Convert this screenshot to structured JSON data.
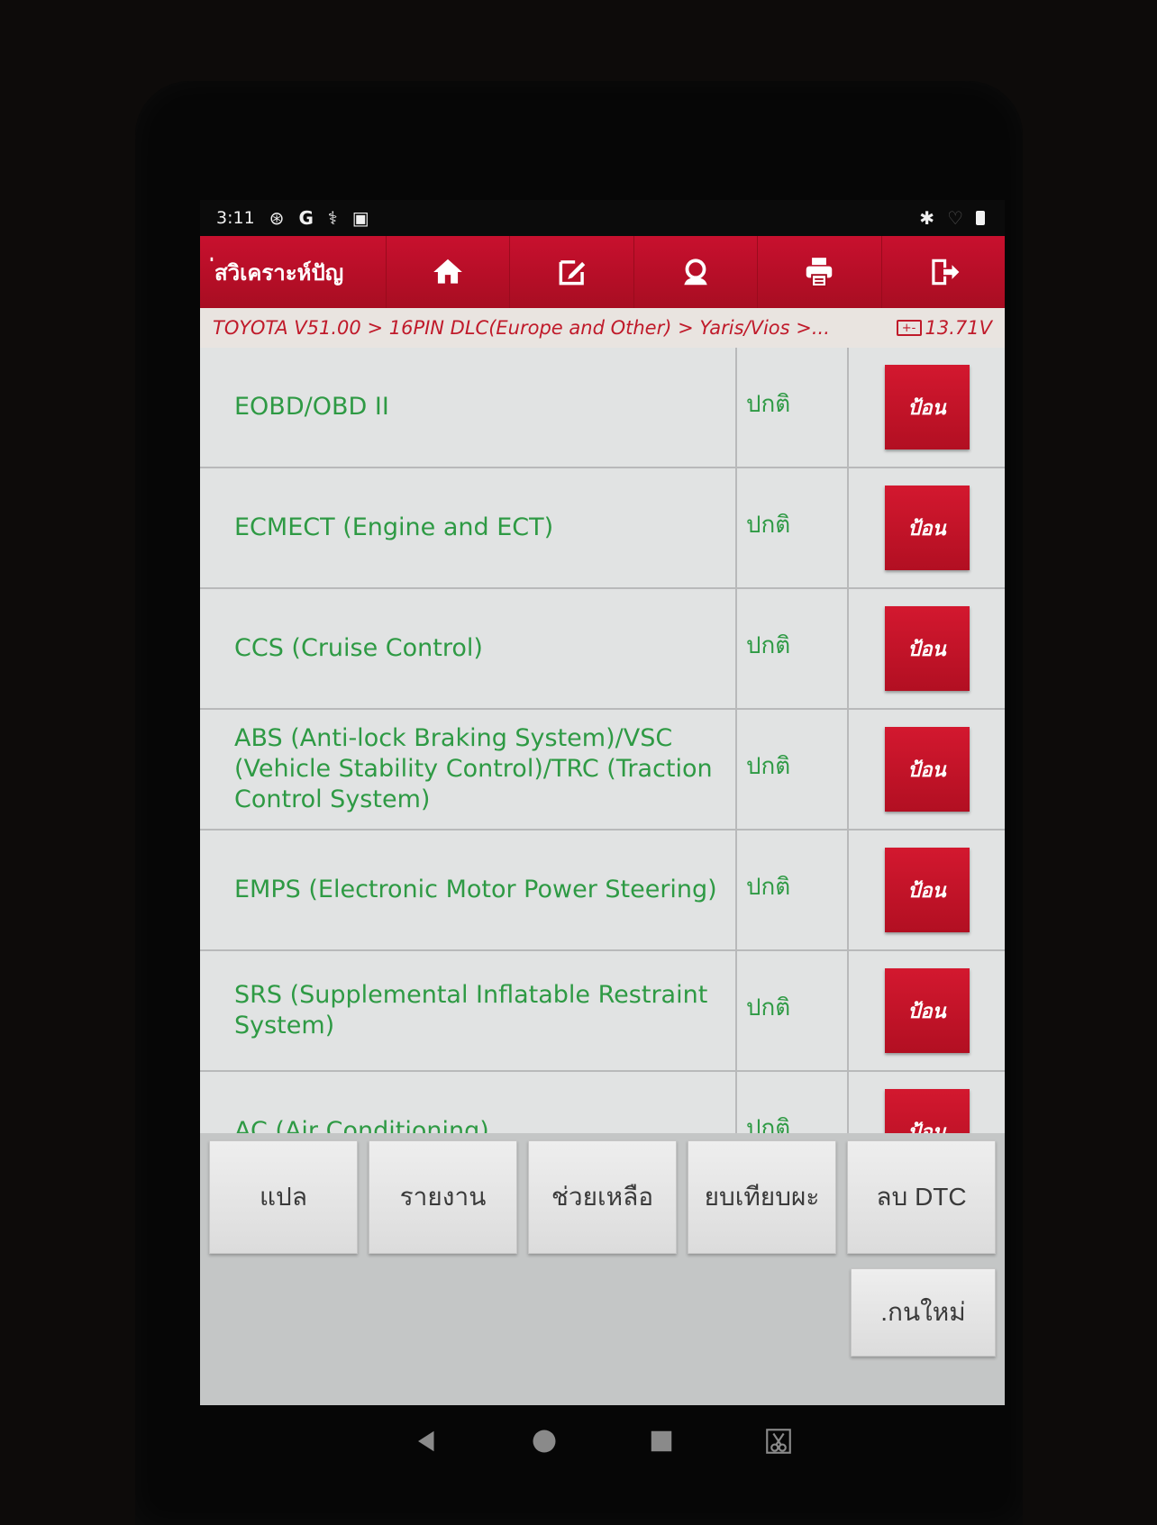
{
  "status_bar": {
    "time": "3:11",
    "icons": [
      "accessibility-icon",
      "google-icon",
      "diagnostic-icon",
      "image-icon"
    ],
    "right_icons": [
      "bluetooth-icon",
      "wifi-icon",
      "battery-icon"
    ]
  },
  "toolbar": {
    "title": "่สวิเคราะห์ปัญ",
    "buttons": [
      "home-icon",
      "edit-note-icon",
      "support-agent-icon",
      "print-icon",
      "exit-icon"
    ]
  },
  "breadcrumb": {
    "path": "TOYOTA V51.00 > 16PIN DLC(Europe and Other) > Yaris/Vios >...",
    "voltage": "13.71V",
    "voltage_icon_text": "+-"
  },
  "systems": [
    {
      "name": "EOBD/OBD II",
      "status": "ปกติ",
      "action": "ป้อน"
    },
    {
      "name": "ECMECT (Engine and ECT)",
      "status": "ปกติ",
      "action": "ป้อน"
    },
    {
      "name": "CCS (Cruise Control)",
      "status": "ปกติ",
      "action": "ป้อน"
    },
    {
      "name": "ABS (Anti-lock Braking System)/VSC (Vehicle Stability Control)/TRC (Traction Control System)",
      "status": "ปกติ",
      "action": "ป้อน"
    },
    {
      "name": "EMPS (Electronic Motor Power Steering)",
      "status": "ปกติ",
      "action": "ป้อน"
    },
    {
      "name": "SRS (Supplemental Inflatable Restraint System)",
      "status": "ปกติ",
      "action": "ป้อน"
    },
    {
      "name": "AC (Air Conditioning)",
      "status": "ปกติ",
      "action": "ป้อน"
    }
  ],
  "function_buttons": {
    "translate": "แปล",
    "report": "รายงาน",
    "help": "ช่วยเหลือ",
    "compare": "ยบเทียบผะ",
    "clear_dtc": "ลบ DTC",
    "rescan": ".กนใหม่"
  },
  "colors": {
    "toolbar_red": "#c8102e",
    "system_text_green": "#2e9a44",
    "breadcrumb_red": "#c01a2a"
  }
}
